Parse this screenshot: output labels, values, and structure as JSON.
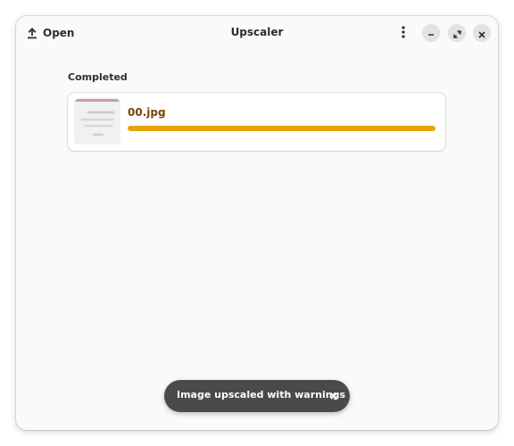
{
  "window": {
    "title": "Upscaler"
  },
  "headerbar": {
    "open_label": "Open",
    "icons": {
      "open": "upload-icon",
      "menu": "vertical-dots-icon",
      "minimize": "minimize-icon",
      "maximize": "maximize-icon",
      "close": "close-icon"
    }
  },
  "main": {
    "section_title": "Completed",
    "items": [
      {
        "filename": "00.jpg",
        "progress": 1.0,
        "thumbnail": "image-thumbnail"
      }
    ]
  },
  "toast": {
    "message": "Image upscaled with warnings",
    "close_icon": "close-icon"
  },
  "colors": {
    "accent": "#e5a50a",
    "filename": "#7a4500",
    "toast_bg": "#4a4a4a",
    "window_bg": "#fafafa"
  }
}
